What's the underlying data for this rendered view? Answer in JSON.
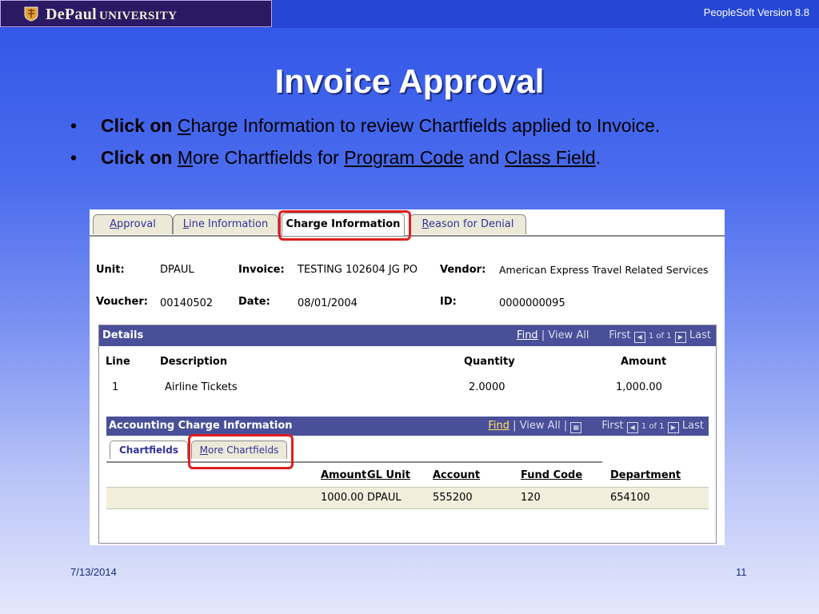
{
  "header": {
    "logo_text_main": "DePaul",
    "logo_text_rest": "University",
    "version": "PeopleSoft Version 8.8"
  },
  "title": "Invoice Approval",
  "bullets": [
    {
      "bold": "Click on",
      "ul": "C",
      "rest": "harge Information to review Chartfields applied to Invoice."
    },
    {
      "bold": "Click on",
      "ul": "M",
      "rest": "ore Chartfields for",
      "link1": "Program Code",
      "and": "and",
      "link2": "Class Field",
      "end": "."
    }
  ],
  "tabs": [
    {
      "ul": "A",
      "rest": "pproval"
    },
    {
      "ul": "L",
      "rest": "ine Information"
    },
    {
      "label": "Charge Information"
    },
    {
      "ul": "R",
      "rest": "eason for Denial"
    }
  ],
  "info": {
    "unit_label": "Unit:",
    "unit": "DPAUL",
    "invoice_label": "Invoice:",
    "invoice": "TESTING 102604 JG PO",
    "vendor_label": "Vendor:",
    "vendor": "American Express Travel Related Services",
    "voucher_label": "Voucher:",
    "voucher": "00140502",
    "date_label": "Date:",
    "date": "08/01/2004",
    "id_label": "ID:",
    "id": "0000000095"
  },
  "details": {
    "title": "Details",
    "find": "Find",
    "viewall": "View All",
    "first": "First",
    "of": "1 of 1",
    "last": "Last",
    "cols": {
      "line": "Line",
      "description": "Description",
      "quantity": "Quantity",
      "amount": "Amount"
    },
    "row": {
      "line": "1",
      "description": "Airline Tickets",
      "quantity": "2.0000",
      "amount": "1,000.00"
    }
  },
  "accounting": {
    "title": "Accounting Charge Information",
    "find": "Find",
    "viewall": "View All",
    "first": "First",
    "of": "1 of 1",
    "last": "Last",
    "tab1": "Chartfields",
    "tab2_ul": "M",
    "tab2_rest": "ore Chartfields",
    "cols": {
      "amount": "Amount",
      "gl_unit": "GL Unit",
      "account": "Account",
      "fund_code": "Fund Code",
      "department": "Department"
    },
    "row": {
      "amount": "1000.00",
      "gl_unit": "DPAUL",
      "account": "555200",
      "fund_code": "120",
      "department": "654100"
    }
  },
  "footer": {
    "date": "7/13/2014",
    "page": "11"
  },
  "colors": {
    "highlight": "#e01e1e",
    "grid_header": "#4a4f99",
    "tab_bg": "#ece9d8"
  }
}
